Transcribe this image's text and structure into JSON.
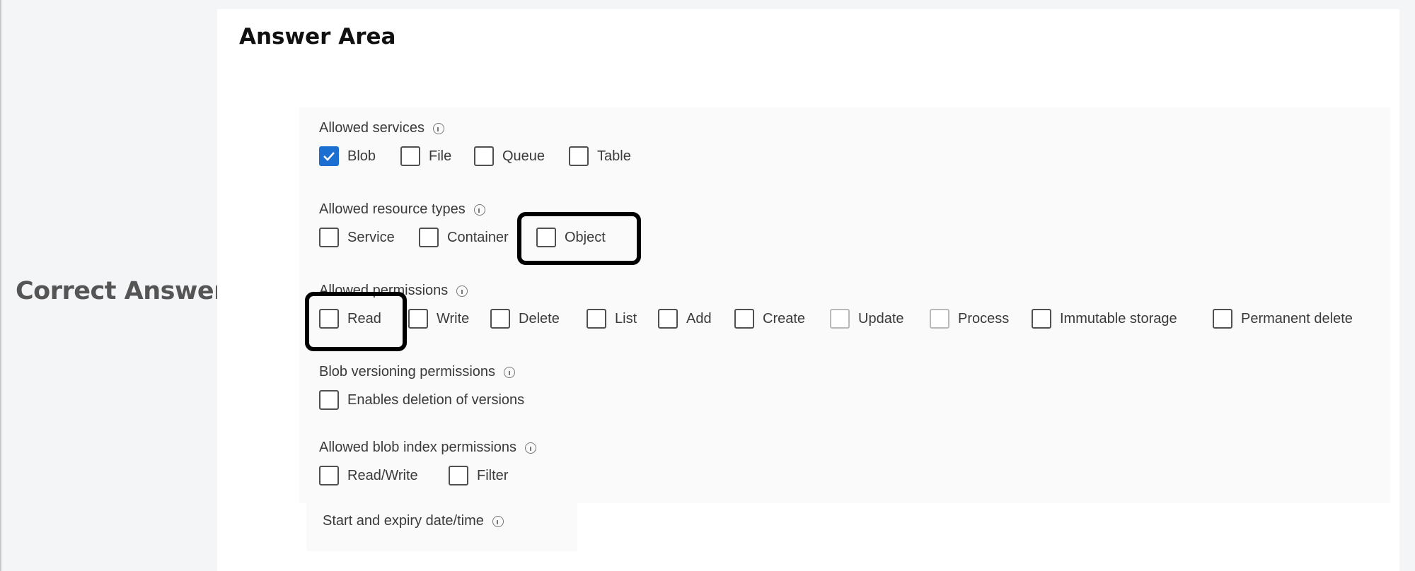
{
  "side_label": "Correct Answer:",
  "answer_title": "Answer Area",
  "sections": {
    "services": {
      "label": "Allowed services",
      "options": [
        {
          "label": "Blob",
          "checked": true
        },
        {
          "label": "File",
          "checked": false
        },
        {
          "label": "Queue",
          "checked": false
        },
        {
          "label": "Table",
          "checked": false
        }
      ]
    },
    "resource_types": {
      "label": "Allowed resource types",
      "options": [
        {
          "label": "Service",
          "checked": false
        },
        {
          "label": "Container",
          "checked": false
        },
        {
          "label": "Object",
          "checked": false,
          "highlighted": true
        }
      ]
    },
    "permissions": {
      "label": "Allowed permissions",
      "options": [
        {
          "label": "Read",
          "checked": false,
          "highlighted": true
        },
        {
          "label": "Write",
          "checked": false
        },
        {
          "label": "Delete",
          "checked": false
        },
        {
          "label": "List",
          "checked": false
        },
        {
          "label": "Add",
          "checked": false
        },
        {
          "label": "Create",
          "checked": false
        },
        {
          "label": "Update",
          "checked": false,
          "disabled": true
        },
        {
          "label": "Process",
          "checked": false,
          "disabled": true
        },
        {
          "label": "Immutable storage",
          "checked": false
        },
        {
          "label": "Permanent delete",
          "checked": false
        }
      ]
    },
    "versioning": {
      "label": "Blob versioning permissions",
      "options": [
        {
          "label": "Enables deletion of versions",
          "checked": false
        }
      ]
    },
    "blob_index": {
      "label": "Allowed blob index permissions",
      "options": [
        {
          "label": "Read/Write",
          "checked": false
        },
        {
          "label": "Filter",
          "checked": false
        }
      ]
    },
    "expiry": {
      "label": "Start and expiry date/time"
    }
  },
  "colors": {
    "checked": "#1b6fd1",
    "highlight": "#000000",
    "side_label": "#555555"
  }
}
